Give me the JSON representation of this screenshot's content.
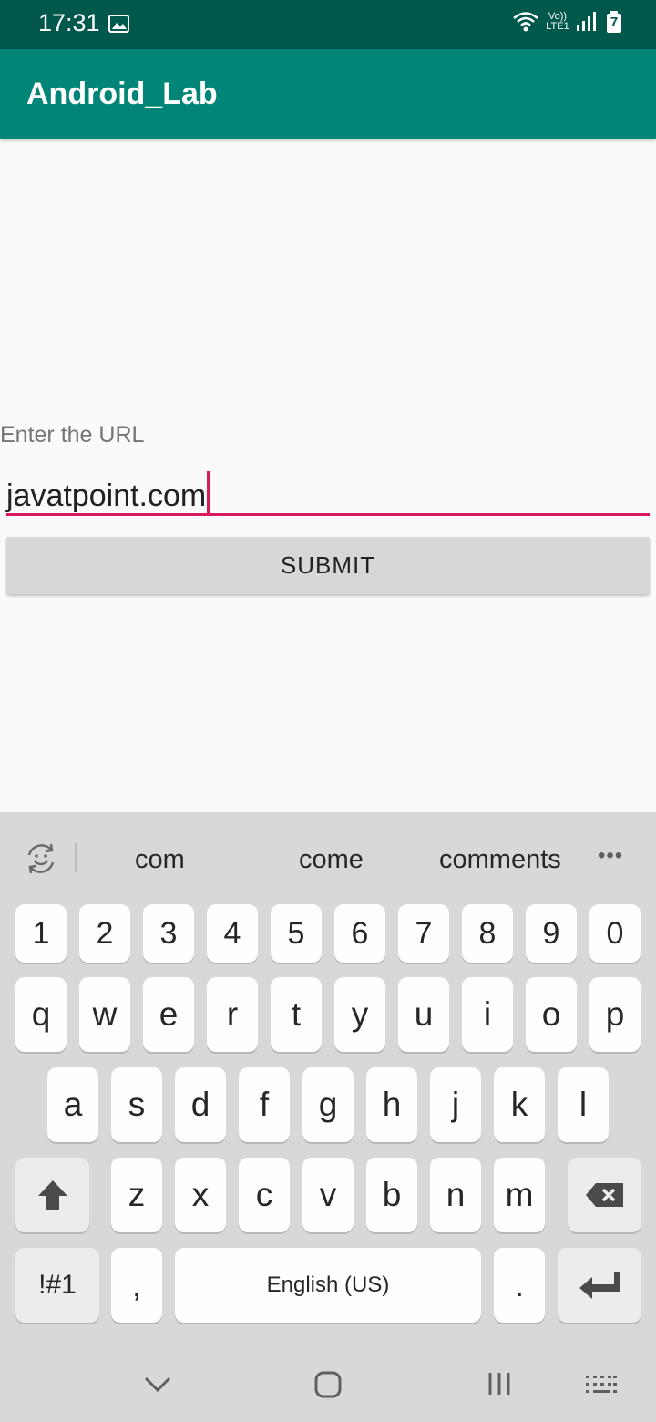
{
  "status_bar": {
    "time": "17:31",
    "network_label": "Vo)) LTE1",
    "battery_level": "7"
  },
  "app_bar": {
    "title": "Android_Lab"
  },
  "form": {
    "label": "Enter the URL",
    "input_value": "javatpoint.com",
    "submit_label": "SUBMIT"
  },
  "keyboard": {
    "suggestions": [
      "com",
      "come",
      "comments"
    ],
    "more_label": "•••",
    "number_row": [
      "1",
      "2",
      "3",
      "4",
      "5",
      "6",
      "7",
      "8",
      "9",
      "0"
    ],
    "row1": [
      "q",
      "w",
      "e",
      "r",
      "t",
      "y",
      "u",
      "i",
      "o",
      "p"
    ],
    "row2": [
      "a",
      "s",
      "d",
      "f",
      "g",
      "h",
      "j",
      "k",
      "l"
    ],
    "row3": [
      "z",
      "x",
      "c",
      "v",
      "b",
      "n",
      "m"
    ],
    "symbols_label": "!#1",
    "comma_label": ",",
    "space_label": "English (US)",
    "period_label": "."
  },
  "colors": {
    "status_bar": "#00574b",
    "app_bar": "#008577",
    "accent": "#d81b60",
    "keyboard_bg": "#d8d8d8"
  },
  "icons": [
    "gallery-icon",
    "wifi-icon",
    "signal-icon",
    "battery-icon",
    "emoji-refresh-icon",
    "shift-icon",
    "backspace-icon",
    "enter-icon",
    "nav-back-icon",
    "nav-home-icon",
    "nav-recents-icon",
    "keyboard-switch-icon"
  ]
}
